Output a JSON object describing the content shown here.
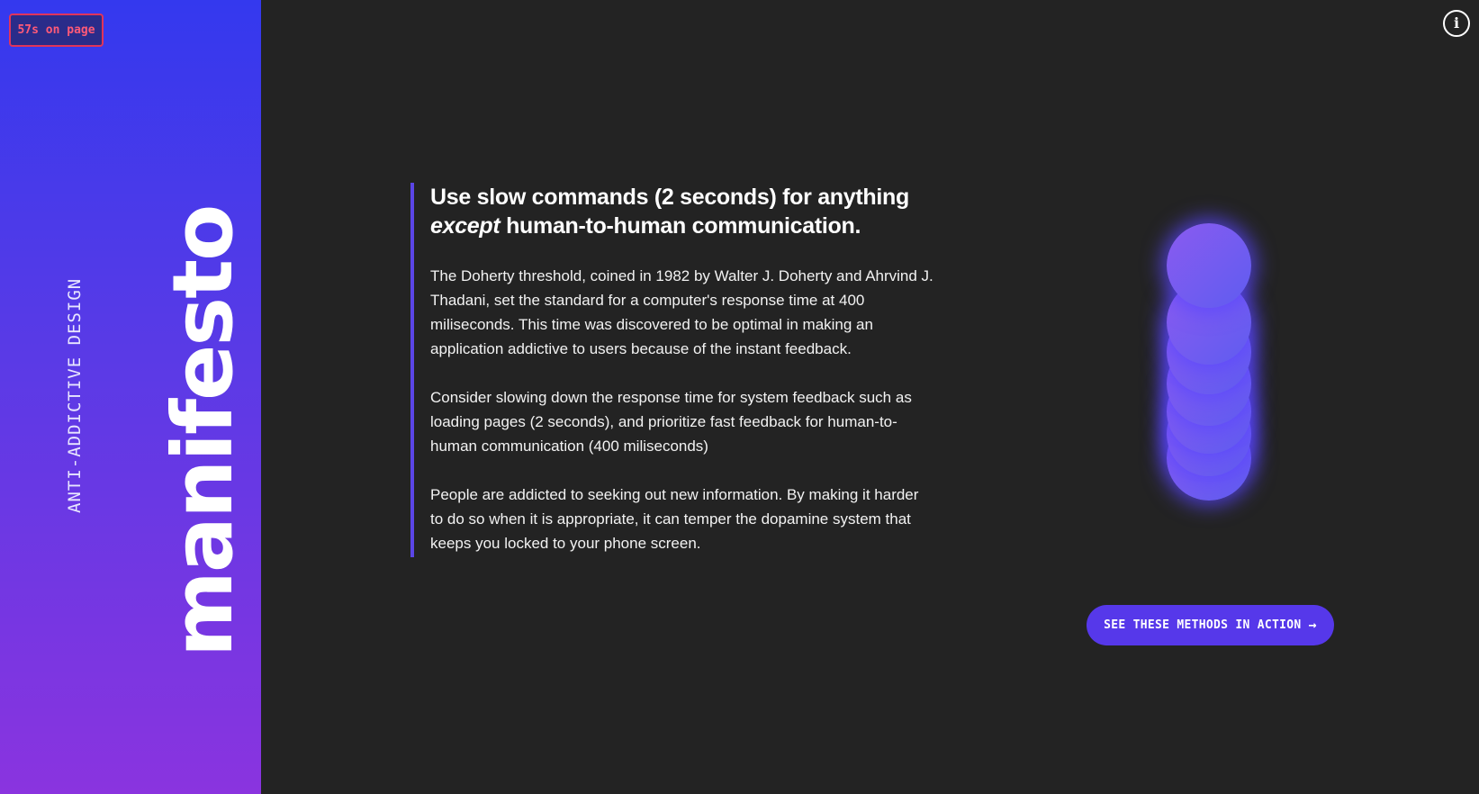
{
  "sidebar": {
    "timer": "57s on page",
    "title": "manifesto",
    "subtitle": "ANTI-ADDICTIVE DESIGN"
  },
  "info_button": {
    "label": "i"
  },
  "article": {
    "heading_part1": "Use slow commands (2 seconds) for anything ",
    "heading_emphasis": "except",
    "heading_part2": " human-to-human communication.",
    "paragraphs": [
      "The Doherty threshold, coined in 1982 by Walter J. Doherty and Ahrvind J. Thadani, set the standard for a computer's response time at 400 miliseconds. This time was discovered to be optimal in making an application addictive to users because of the instant feedback.",
      "Consider slowing down the response time for system feedback such as loading pages (2 seconds), and prioritize fast feedback for human-to-human communication (400 miliseconds)",
      "People are addicted to seeking out new information. By making it harder to do so when it is appropriate, it can temper the dopamine system that keeps you locked to your phone screen."
    ]
  },
  "cta": {
    "label": "SEE THESE METHODS IN ACTION",
    "icon": "arrow-right-icon"
  },
  "colors": {
    "accent": "#5638ea",
    "sidebar_top": "#3439ee",
    "sidebar_bottom": "#8a34df",
    "timer_text": "#ff5a78",
    "background": "#232323"
  }
}
